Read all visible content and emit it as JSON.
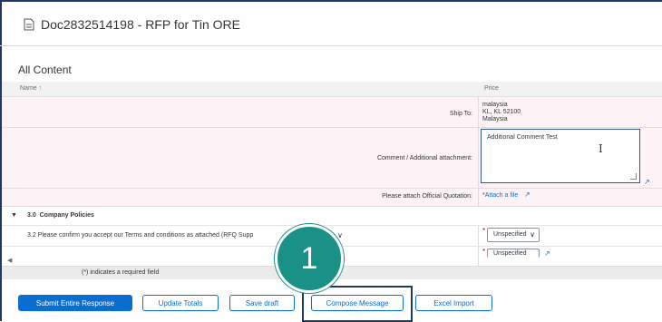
{
  "document": {
    "title": "Doc2832514198 - RFP for Tin ORE"
  },
  "section": {
    "title": "All Content"
  },
  "table": {
    "columns": {
      "name": "Name ↑",
      "price": "Price"
    },
    "ship_to": {
      "label": "Ship To:",
      "lines": [
        "malaysia",
        "KL, KL 52100",
        "Malaysia"
      ]
    },
    "comment": {
      "label": "Comment / Additional attachment:",
      "value": "Additional Comment Test"
    },
    "quotation": {
      "label": "Please attach Official Quotation:",
      "required": "*",
      "link": "Attach a file"
    },
    "group": {
      "toggle": "▼",
      "number": "3.0",
      "label": "Company Policies"
    },
    "q32": {
      "text": "3.2  Please confirm you accept our Terms and conditions as attached (RFQ Supp",
      "trail": "∨",
      "required": "*",
      "value": "Unspecified"
    },
    "q33": {
      "required": "*",
      "value": "Unspecified"
    }
  },
  "footer": {
    "required_note": "(*) indicates a required field"
  },
  "buttons": {
    "submit": "Submit Entire Response",
    "update": "Update Totals",
    "save": "Save draft",
    "compose": "Compose Message",
    "excel": "Excel Import"
  },
  "callout": {
    "number": "1"
  },
  "colors": {
    "accent": "#0a6ed1",
    "callout": "#1a9186",
    "highlight": "#1f3864",
    "row_bg": "#fdf3f6"
  }
}
